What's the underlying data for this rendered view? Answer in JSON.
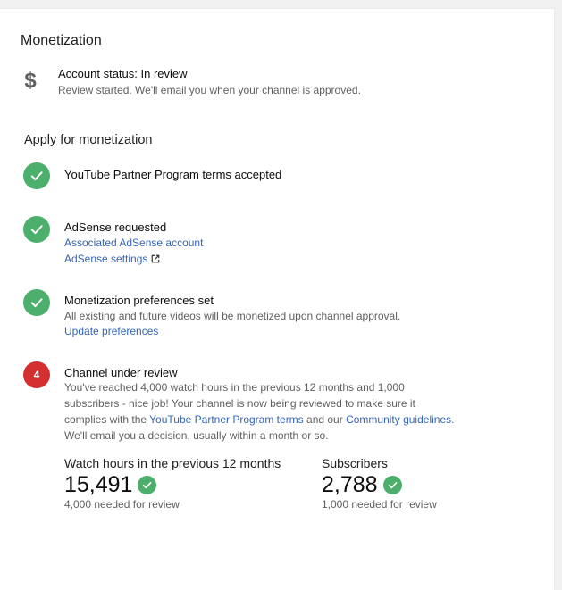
{
  "monetization": {
    "title": "Monetization",
    "account_status": "Account status: In review",
    "account_status_sub": "Review started. We'll email you when your channel is approved.",
    "dollar_icon": "$",
    "apply_heading": "Apply for monetization"
  },
  "steps": [
    {
      "icon": "check-icon",
      "title": "YouTube Partner Program terms accepted"
    },
    {
      "icon": "check-icon",
      "title": "AdSense requested",
      "link1": "Associated AdSense account",
      "link2": "AdSense settings"
    },
    {
      "icon": "check-icon",
      "title": "Monetization preferences set",
      "text": "All existing and future videos will be monetized upon channel approval.",
      "link1": "Update preferences"
    },
    {
      "icon": "number-badge",
      "number": "4",
      "title": "Channel under review",
      "text_part1": "You've reached 4,000 watch hours in the previous 12 months and 1,000 subscribers - nice job! Your channel is now being reviewed to make sure it complies with the ",
      "link_terms": "YouTube Partner Program terms",
      "text_part2": " and our ",
      "link_guidelines": "Community guidelines",
      "text_part3": ".",
      "text_part4": "We'll email you a decision, usually within a month or so."
    }
  ],
  "stats": {
    "watch": {
      "label": "Watch hours in the previous 12 months",
      "value": "15,491",
      "note": "4,000 needed for review"
    },
    "subs": {
      "label": "Subscribers",
      "value": "2,788",
      "note": "1,000 needed for review"
    }
  },
  "colors": {
    "check_green": "#4caf6b",
    "badge_red": "#d32f2f",
    "link_blue": "#3565b8"
  }
}
